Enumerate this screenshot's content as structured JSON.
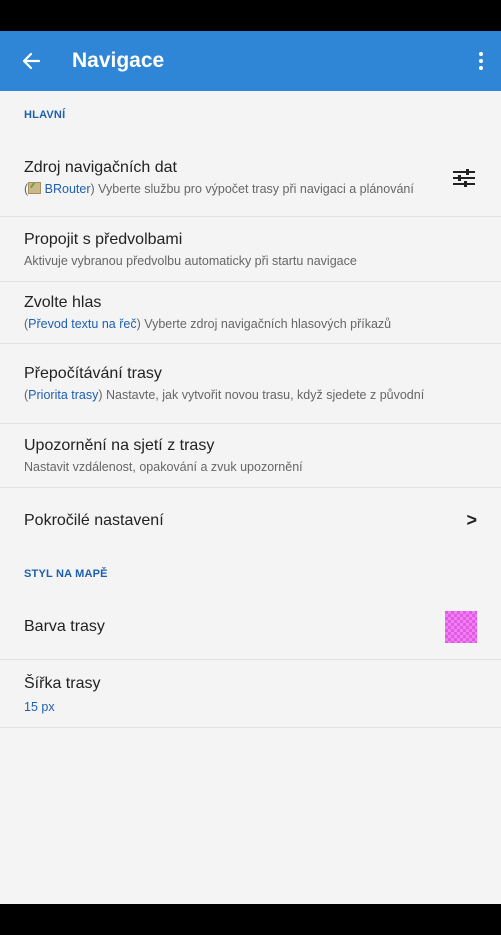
{
  "app_bar": {
    "title": "Navigace",
    "back_icon": "arrow-back-icon",
    "menu_icon": "more-vert-icon",
    "color": "#2f86d6"
  },
  "sections": {
    "main": {
      "header": "HLAVNÍ"
    },
    "map_style": {
      "header": "STYL NA MAPĚ"
    }
  },
  "prefs": {
    "nav_source": {
      "title": "Zdroj navigačních dat",
      "summary_accent": "BRouter",
      "summary_close": ")",
      "summary_open": "(",
      "summary_text": " Vyberte službu pro výpočet trasy při navigaci a plánování",
      "icon": "tune-icon"
    },
    "presets": {
      "title": "Propojit s předvolbami",
      "summary": "Aktivuje vybranou předvolbu automaticky při startu navigace"
    },
    "voice": {
      "title": "Zvolte hlas",
      "summary_open": "(",
      "summary_accent": "Převod textu na řeč",
      "summary_close": ")",
      "summary_text": " Vyberte zdroj navigačních hlasových příkazů"
    },
    "recalc": {
      "title": "Přepočítávání trasy",
      "summary_open": "(",
      "summary_accent": "Priorita trasy",
      "summary_close": ")",
      "summary_text": " Nastavte, jak vytvořit novou trasu, když sjedete z původní"
    },
    "off_route": {
      "title": "Upozornění na sjetí z trasy",
      "summary": "Nastavit vzdálenost, opakování a zvuk upozornění"
    },
    "advanced": {
      "title": "Pokročilé nastavení",
      "chevron": ">"
    },
    "route_color": {
      "title": "Barva trasy",
      "color": "#e25be4"
    },
    "route_width": {
      "title": "Šířka trasy",
      "value": "15 px"
    }
  }
}
